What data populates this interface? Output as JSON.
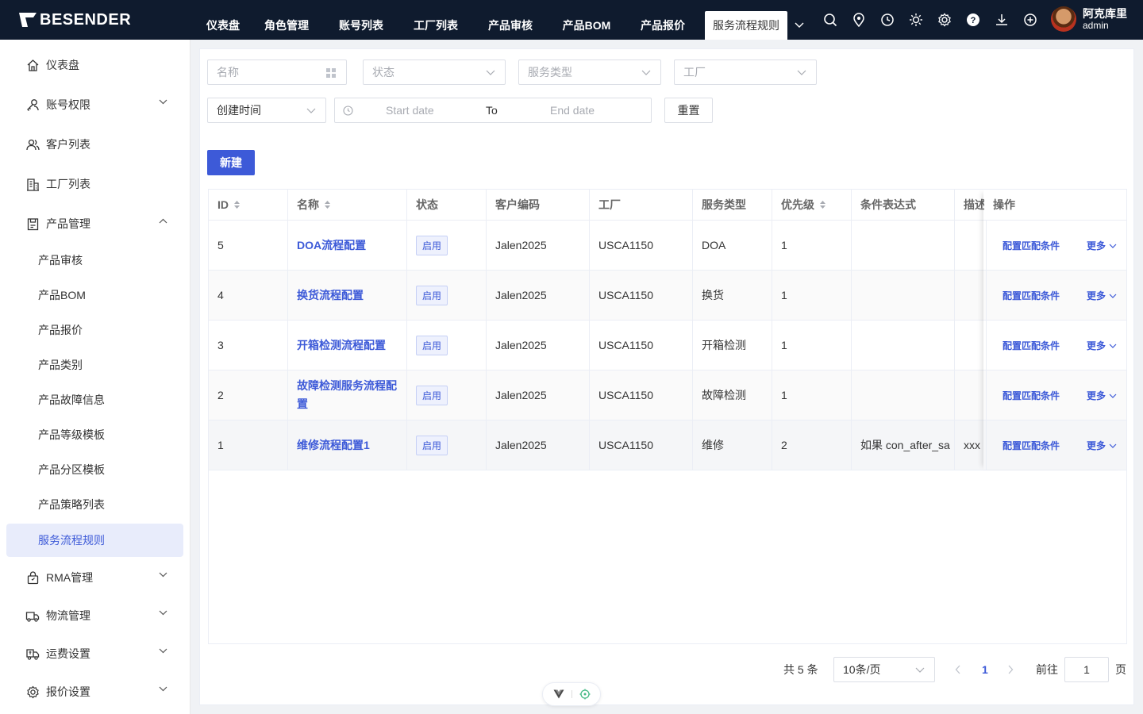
{
  "brand": "BESENDER",
  "nav": {
    "tabs": [
      "仪表盘",
      "角色管理",
      "账号列表",
      "工厂列表",
      "产品审核",
      "产品BOM",
      "产品报价",
      "服务流程规则"
    ],
    "active_index": 7
  },
  "user": {
    "name": "阿克库里",
    "role": "admin"
  },
  "sidebar": {
    "items": [
      {
        "label": "仪表盘",
        "icon": "home-icon"
      },
      {
        "label": "账号权限",
        "icon": "key-user-icon"
      },
      {
        "label": "客户列表",
        "icon": "users-icon"
      },
      {
        "label": "工厂列表",
        "icon": "building-icon"
      },
      {
        "label": "产品管理",
        "icon": "product-icon"
      },
      {
        "label": "RMA管理",
        "icon": "lock-bag-icon"
      },
      {
        "label": "物流管理",
        "icon": "truck-icon"
      },
      {
        "label": "运费设置",
        "icon": "freight-icon"
      },
      {
        "label": "报价设置",
        "icon": "gear-icon"
      }
    ],
    "product_sub": [
      "产品审核",
      "产品BOM",
      "产品报价",
      "产品类别",
      "产品故障信息",
      "产品等级模板",
      "产品分区模板",
      "产品策略列表",
      "服务流程规则"
    ]
  },
  "filters": {
    "name_placeholder": "名称",
    "status_placeholder": "状态",
    "service_type_placeholder": "服务类型",
    "factory_placeholder": "工厂",
    "time_select": "创建时间",
    "start_placeholder": "Start date",
    "range_sep": "To",
    "end_placeholder": "End date",
    "reset": "重置"
  },
  "actions": {
    "new": "新建"
  },
  "table": {
    "headers": {
      "id": "ID",
      "name": "名称",
      "status": "状态",
      "customer_code": "客户编码",
      "factory": "工厂",
      "service_type": "服务类型",
      "priority": "优先级",
      "condition": "条件表达式",
      "desc": "描述",
      "ops": "操作"
    },
    "rows": [
      {
        "id": "5",
        "name": "DOA流程配置",
        "status": "启用",
        "customer": "Jalen2025",
        "factory": "USCA1150",
        "type": "DOA",
        "priority": "1",
        "condition": "",
        "desc": ""
      },
      {
        "id": "4",
        "name": "换货流程配置",
        "status": "启用",
        "customer": "Jalen2025",
        "factory": "USCA1150",
        "type": "换货",
        "priority": "1",
        "condition": "",
        "desc": ""
      },
      {
        "id": "3",
        "name": "开箱检测流程配置",
        "status": "启用",
        "customer": "Jalen2025",
        "factory": "USCA1150",
        "type": "开箱检测",
        "priority": "1",
        "condition": "",
        "desc": ""
      },
      {
        "id": "2",
        "name": "故障检测服务流程配置",
        "status": "启用",
        "customer": "Jalen2025",
        "factory": "USCA1150",
        "type": "故障检测",
        "priority": "1",
        "condition": "",
        "desc": ""
      },
      {
        "id": "1",
        "name": "维修流程配置1",
        "status": "启用",
        "customer": "Jalen2025",
        "factory": "USCA1150",
        "type": "维修",
        "priority": "2",
        "condition": "如果 con_after_sa",
        "desc": "xxx"
      }
    ],
    "op_config": "配置匹配条件",
    "op_more": "更多"
  },
  "pagination": {
    "total": "共 5 条",
    "page_size": "10条/页",
    "current": "1",
    "goto_prefix": "前往",
    "goto_value": "1",
    "goto_suffix": "页"
  },
  "colors": {
    "primary": "#3d5ad8",
    "topbar": "#0f1b2e"
  }
}
